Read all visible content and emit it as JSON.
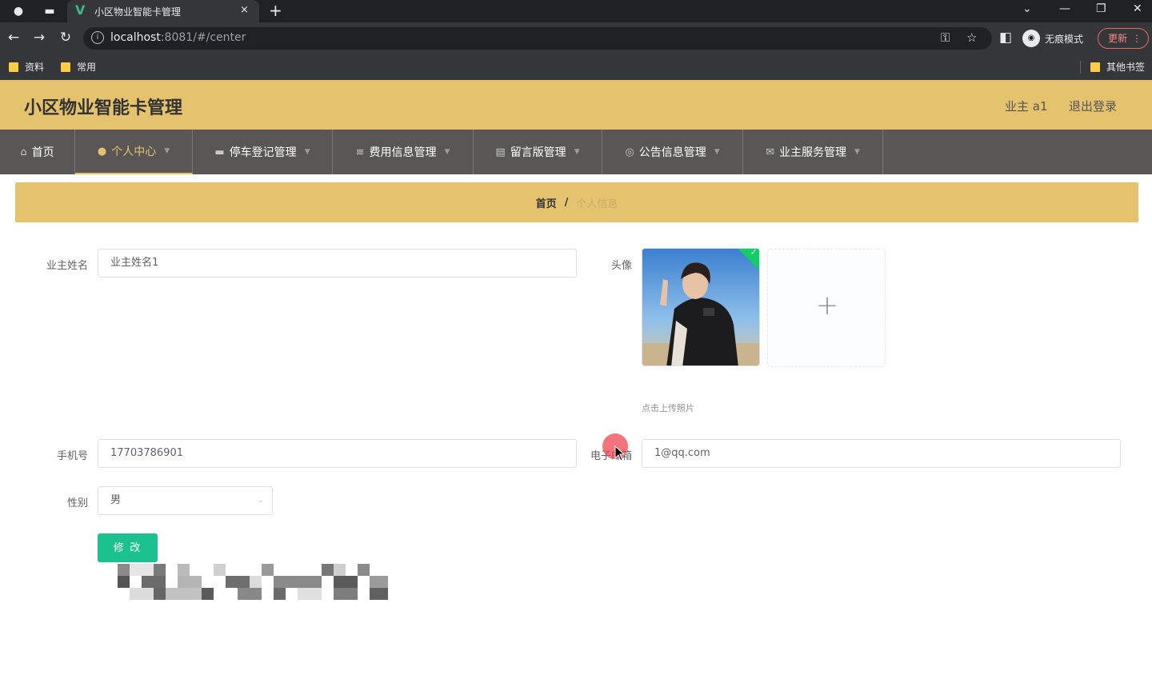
{
  "browser": {
    "tab_title": "小区物业智能卡管理",
    "tab_close": "×",
    "new_tab": "+",
    "url_host": "localhost",
    "url_rest": ":8081/#/center",
    "incognito_label": "无痕模式",
    "update_label": "更新",
    "bookmarks": [
      "资料",
      "常用"
    ],
    "other_bookmarks": "其他书签"
  },
  "app": {
    "title": "小区物业智能卡管理",
    "user": "业主 a1",
    "logout": "退出登录"
  },
  "nav": {
    "items": [
      {
        "label": "首页",
        "icon": "home-icon"
      },
      {
        "label": "个人中心",
        "icon": "user-icon"
      },
      {
        "label": "停车登记管理",
        "icon": "briefcase-icon"
      },
      {
        "label": "费用信息管理",
        "icon": "list-icon"
      },
      {
        "label": "留言版管理",
        "icon": "document-icon"
      },
      {
        "label": "公告信息管理",
        "icon": "bell-icon"
      },
      {
        "label": "业主服务管理",
        "icon": "mail-icon"
      }
    ]
  },
  "breadcrumb": {
    "home": "首页",
    "sep": "/",
    "current": "个人信息"
  },
  "form": {
    "name_label": "业主姓名",
    "name_value": "业主姓名1",
    "avatar_label": "头像",
    "upload_tip": "点击上传照片",
    "upload_plus": "+",
    "phone_label": "手机号",
    "phone_value": "17703786901",
    "email_label": "电子邮箱",
    "email_value": "1@qq.com",
    "gender_label": "性别",
    "gender_value": "男",
    "submit_label": "修 改"
  }
}
